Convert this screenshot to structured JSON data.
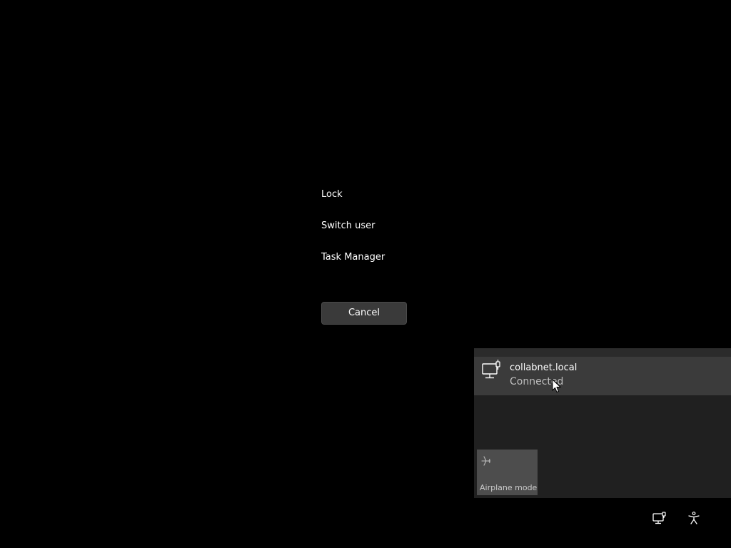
{
  "secure_options": {
    "lock": "Lock",
    "switch_user": "Switch user",
    "task_manager": "Task Manager"
  },
  "cancel_label": "Cancel",
  "network_flyout": {
    "network_name": "collabnet.local",
    "network_status": "Connected",
    "network_icon": "wired-network-icon",
    "airplane_label": "Airplane mode",
    "airplane_icon": "airplane-icon"
  },
  "tray": {
    "icons": [
      "network-icon",
      "accessibility-icon"
    ]
  },
  "colors": {
    "background": "#000000",
    "button": "#3a3a3a",
    "flyout": "#202020",
    "network_item": "#3b3b3b",
    "tile": "#4d4d4d"
  }
}
